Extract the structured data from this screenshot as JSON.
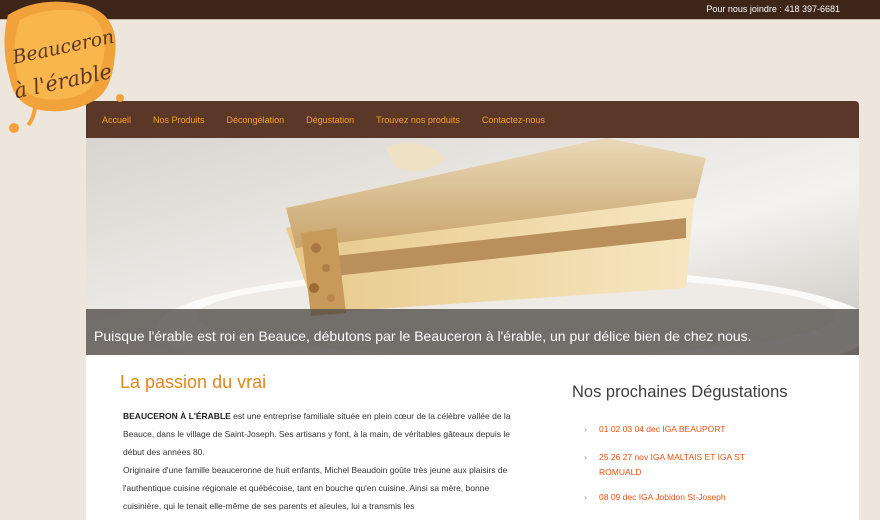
{
  "topbar": {
    "contact": "Pour nous joindre : 418 397-6681"
  },
  "logo": {
    "line1": "Beauceron",
    "line2": "à l'érable"
  },
  "nav": {
    "items": [
      "Accueil",
      "Nos Produits",
      "Décongélation",
      "Dégustation",
      "Trouvez nos produits",
      "Contactez-nous"
    ]
  },
  "hero": {
    "caption": "Puisque l'érable est roi en Beauce, débutons par le Beauceron à l'érable, un pur délice bien de chez nous."
  },
  "main": {
    "title": "La passion du vrai",
    "company": "BEAUCERON À L'ÉRABLE",
    "p1_rest": " est une entreprise familiale située en plein cœur de la célèbre vallée de la Beauce, dans le village de Saint-Joseph. Ses artisans y font, à la main, de véritables gâteaux depuis le début des années 80.",
    "p2": "Originaire d'une famille beauceronne de huit enfants, Michel Beaudoin goûte très jeune aux plaisirs de l'authentique cuisine régionale et québécoise, tant en bouche qu'en cuisine. Ainsi sa mère, bonne cuisinière, qui le tenait elle-même de ses parents et aïeules, lui a transmis les"
  },
  "side": {
    "title": "Nos prochaines Dégustations",
    "events": [
      "01 02 03 04 dec IGA BEAUPORT",
      "25 26 27 nov IGA MALTAIS ET IGA ST ROMUALD",
      "08 09 dec IGA Jobidon St-Joseph"
    ]
  },
  "colors": {
    "accent": "#f6a228",
    "nav_bg": "#5a3727",
    "topbar_bg": "#3d2518",
    "title": "#e0861a",
    "event": "#e5530f",
    "page_bg": "#ece6dc"
  }
}
